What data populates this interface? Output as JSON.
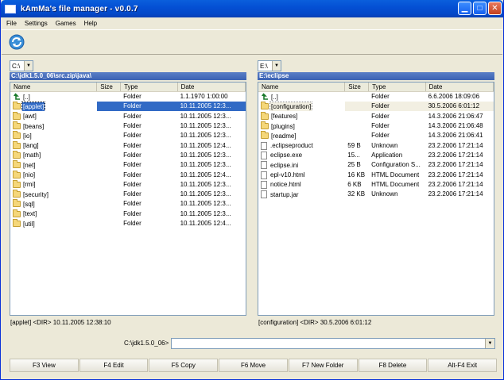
{
  "window": {
    "title": "kAmMa's file manager - v0.0.7"
  },
  "menu": [
    "File",
    "Settings",
    "Games",
    "Help"
  ],
  "columns": [
    "Name",
    "Size",
    "Type",
    "Date"
  ],
  "left": {
    "drive": "C:\\",
    "path": "C:\\jdk1.5.0_06\\src.zip\\java\\",
    "rows": [
      {
        "icon": "up",
        "name": "[..]",
        "size": "",
        "type": "Folder",
        "date": "1.1.1970 1:00:00"
      },
      {
        "icon": "folder",
        "name": "[applet]",
        "size": "",
        "type": "Folder",
        "date": "10.11.2005 12:3...",
        "state": "sel"
      },
      {
        "icon": "folder",
        "name": "[awt]",
        "size": "",
        "type": "Folder",
        "date": "10.11.2005 12:3..."
      },
      {
        "icon": "folder",
        "name": "[beans]",
        "size": "",
        "type": "Folder",
        "date": "10.11.2005 12:3..."
      },
      {
        "icon": "folder",
        "name": "[io]",
        "size": "",
        "type": "Folder",
        "date": "10.11.2005 12:3..."
      },
      {
        "icon": "folder",
        "name": "[lang]",
        "size": "",
        "type": "Folder",
        "date": "10.11.2005 12:4..."
      },
      {
        "icon": "folder",
        "name": "[math]",
        "size": "",
        "type": "Folder",
        "date": "10.11.2005 12:3..."
      },
      {
        "icon": "folder",
        "name": "[net]",
        "size": "",
        "type": "Folder",
        "date": "10.11.2005 12:3..."
      },
      {
        "icon": "folder",
        "name": "[nio]",
        "size": "",
        "type": "Folder",
        "date": "10.11.2005 12:4..."
      },
      {
        "icon": "folder",
        "name": "[rmi]",
        "size": "",
        "type": "Folder",
        "date": "10.11.2005 12:3..."
      },
      {
        "icon": "folder",
        "name": "[security]",
        "size": "",
        "type": "Folder",
        "date": "10.11.2005 12:3..."
      },
      {
        "icon": "folder",
        "name": "[sql]",
        "size": "",
        "type": "Folder",
        "date": "10.11.2005 12:3..."
      },
      {
        "icon": "folder",
        "name": "[text]",
        "size": "",
        "type": "Folder",
        "date": "10.11.2005 12:3..."
      },
      {
        "icon": "folder",
        "name": "[util]",
        "size": "",
        "type": "Folder",
        "date": "10.11.2005 12:4..."
      }
    ],
    "status": "[applet] <DIR>  10.11.2005 12:38:10"
  },
  "right": {
    "drive": "E:\\",
    "path": "E:\\eclipse",
    "rows": [
      {
        "icon": "up",
        "name": "[..]",
        "size": "",
        "type": "Folder",
        "date": "6.6.2006 18:09:06"
      },
      {
        "icon": "folder",
        "name": "[configuration]",
        "size": "",
        "type": "Folder",
        "date": "30.5.2006 6:01:12",
        "state": "hl"
      },
      {
        "icon": "folder",
        "name": "[features]",
        "size": "",
        "type": "Folder",
        "date": "14.3.2006 21:06:47"
      },
      {
        "icon": "folder",
        "name": "[plugins]",
        "size": "",
        "type": "Folder",
        "date": "14.3.2006 21:06:48"
      },
      {
        "icon": "folder",
        "name": "[readme]",
        "size": "",
        "type": "Folder",
        "date": "14.3.2006 21:06:41"
      },
      {
        "icon": "file",
        "name": ".eclipseproduct",
        "size": "59 B",
        "type": "Unknown",
        "date": "23.2.2006 17:21:14"
      },
      {
        "icon": "file",
        "name": "eclipse.exe",
        "size": "15...",
        "type": "Application",
        "date": "23.2.2006 17:21:14"
      },
      {
        "icon": "file",
        "name": "eclipse.ini",
        "size": "25 B",
        "type": "Configuration S...",
        "date": "23.2.2006 17:21:14"
      },
      {
        "icon": "file",
        "name": "epl-v10.html",
        "size": "16 KB",
        "type": "HTML Document",
        "date": "23.2.2006 17:21:14"
      },
      {
        "icon": "file",
        "name": "notice.html",
        "size": "6 KB",
        "type": "HTML Document",
        "date": "23.2.2006 17:21:14"
      },
      {
        "icon": "file",
        "name": "startup.jar",
        "size": "32 KB",
        "type": "Unknown",
        "date": "23.2.2006 17:21:14"
      }
    ],
    "status": "[configuration]  <DIR>  30.5.2006 6:01:12"
  },
  "command": {
    "label": "C:\\jdk1.5.0_06>",
    "value": ""
  },
  "fkeys": [
    "F3 View",
    "F4 Edit",
    "F5 Copy",
    "F6 Move",
    "F7 New Folder",
    "F8 Delete",
    "Alt-F4 Exit"
  ]
}
